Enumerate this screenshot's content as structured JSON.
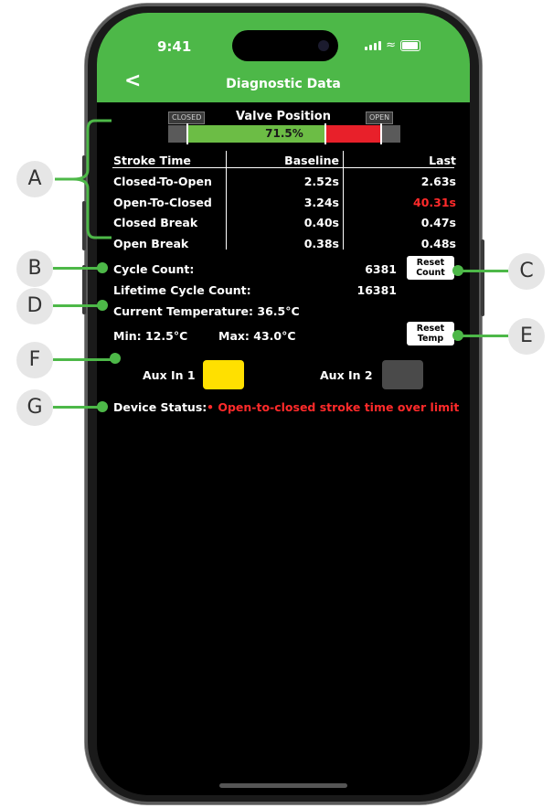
{
  "status_bar": {
    "time": "9:41"
  },
  "nav": {
    "back_icon": "chevron-left-icon",
    "back_glyph": "<",
    "title": "Diagnostic Data"
  },
  "valve": {
    "title": "Valve Position",
    "closed_tag": "CLOSED",
    "open_tag": "OPEN",
    "position_label": "71.5%",
    "position_fraction": 0.715,
    "colors": {
      "fill": "#6cbd45",
      "over": "#e8202a"
    }
  },
  "stroke_table": {
    "headers": [
      "Stroke Time",
      "Baseline",
      "Last"
    ],
    "rows": [
      {
        "label": "Closed-To-Open",
        "baseline": "2.52s",
        "last": "2.63s",
        "alert": false
      },
      {
        "label": "Open-To-Closed",
        "baseline": "3.24s",
        "last": "40.31s",
        "alert": true
      },
      {
        "label": "Closed Break",
        "baseline": "0.40s",
        "last": "0.47s",
        "alert": false
      },
      {
        "label": "Open Break",
        "baseline": "0.38s",
        "last": "0.48s",
        "alert": false
      }
    ]
  },
  "cycle": {
    "count_label": "Cycle Count:",
    "count_value": "6381",
    "lifetime_label": "Lifetime Cycle Count:",
    "lifetime_value": "16381",
    "reset_line1": "Reset",
    "reset_line2": "Count"
  },
  "temperature": {
    "current": "Current Temperature: 36.5°C",
    "min": "Min: 12.5°C",
    "max": "Max: 43.0°C",
    "reset_line1": "Reset",
    "reset_line2": "Temp"
  },
  "aux": {
    "aux1_label": "Aux In 1",
    "aux2_label": "Aux In 2",
    "aux1_color": "#ffe000",
    "aux2_color": "#4a4a4a"
  },
  "device_status": {
    "label": "Device Status:",
    "message": "• Open-to-closed stroke time over limit",
    "message_color": "#ff2a2a"
  },
  "callouts": [
    "A",
    "B",
    "C",
    "D",
    "E",
    "F",
    "G"
  ],
  "accent": "#4db848"
}
